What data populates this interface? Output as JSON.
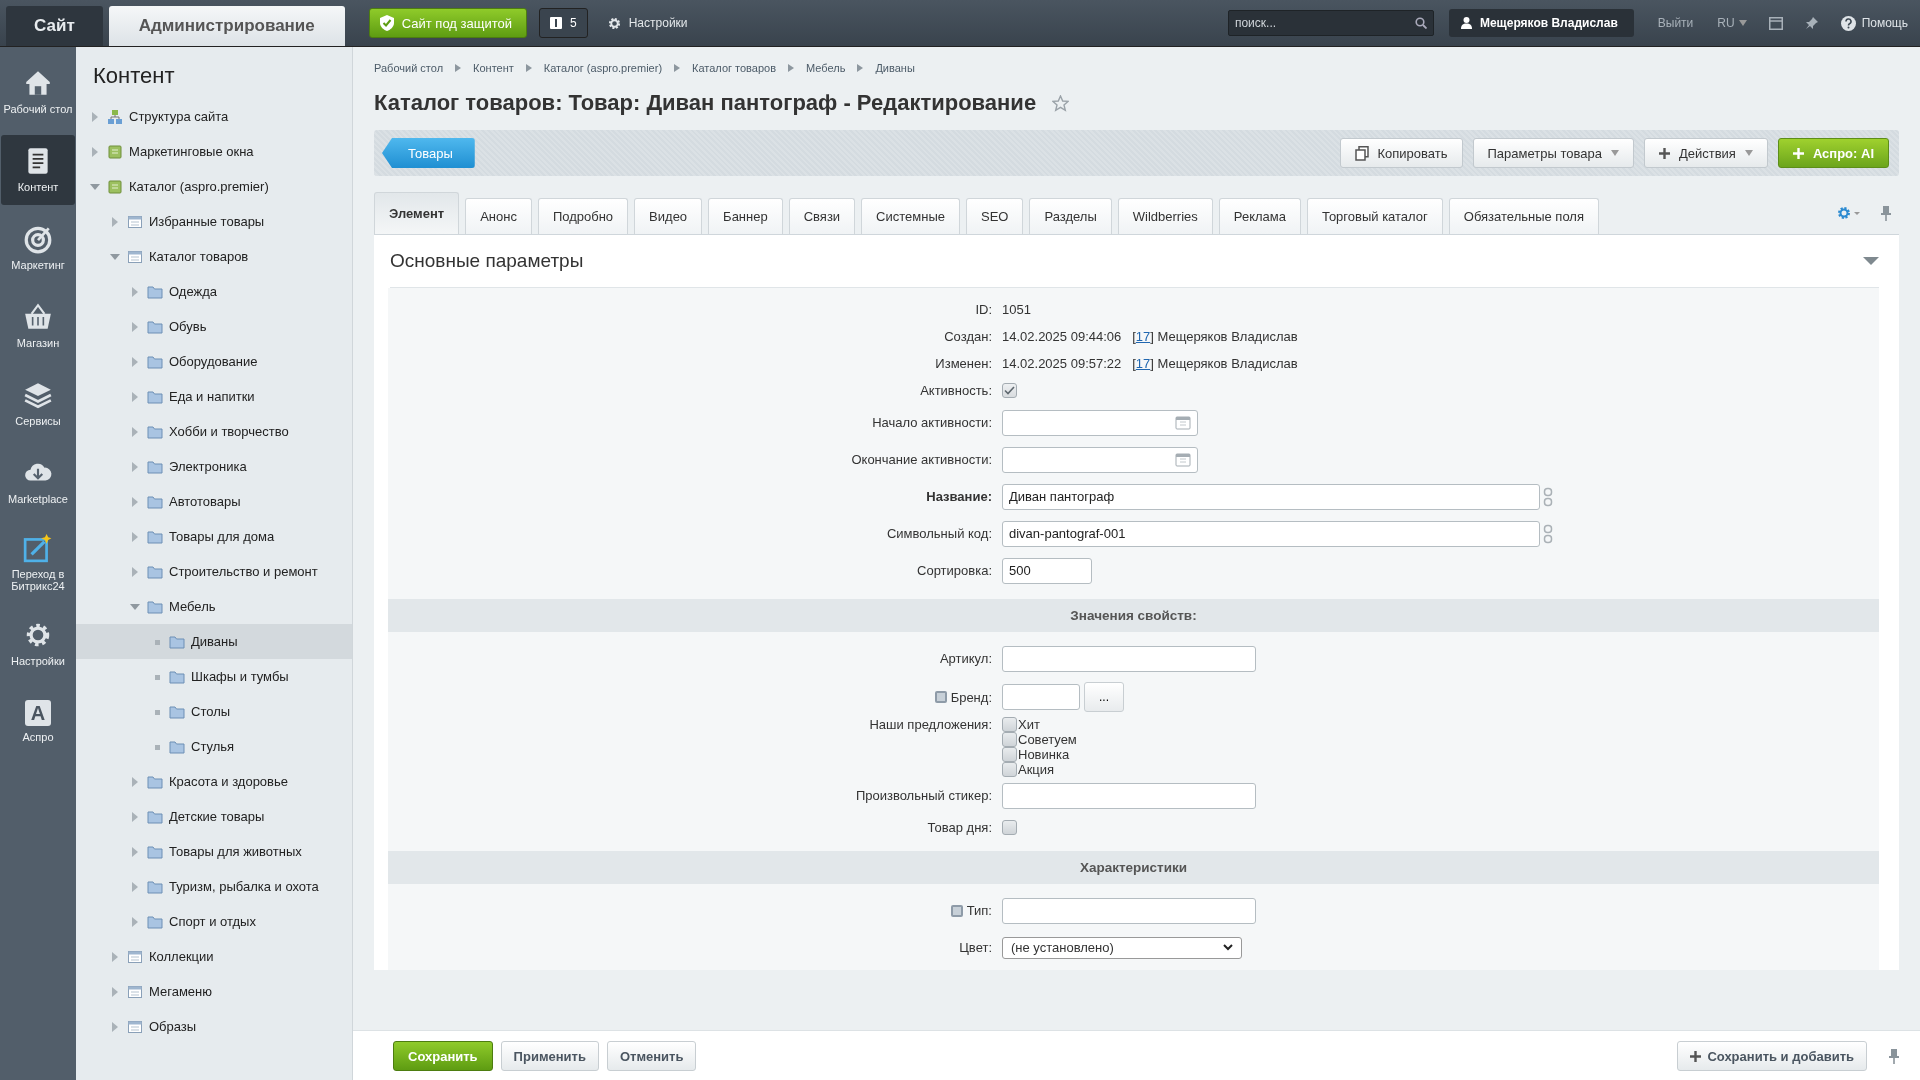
{
  "topbar": {
    "tabs": [
      {
        "label": "Сайт",
        "selected": false
      },
      {
        "label": "Администрирование",
        "selected": true
      }
    ],
    "secure_button": "Сайт под защитой",
    "notifications": "5",
    "settings": "Настройки",
    "search": {
      "placeholder": "поиск..."
    },
    "user": "Мещеряков Владислав",
    "logout": "Выйти",
    "language": "RU",
    "help": "Помощь"
  },
  "nav": [
    {
      "label": "Рабочий стол",
      "selected": false
    },
    {
      "label": "Контент",
      "selected": true
    },
    {
      "label": "Маркетинг",
      "selected": false
    },
    {
      "label": "Магазин",
      "selected": false
    },
    {
      "label": "Сервисы",
      "selected": false
    },
    {
      "label": "Marketplace",
      "selected": false
    },
    {
      "label": "Переход в Битрикс24",
      "selected": false
    },
    {
      "label": "Настройки",
      "selected": false
    },
    {
      "label": "Аспро",
      "glyph": "A",
      "selected": false
    }
  ],
  "tree": {
    "title": "Контент",
    "items": [
      {
        "label": "Структура сайта",
        "expanded": false,
        "selected": false
      },
      {
        "label": "Маркетинговые окна",
        "expanded": false,
        "selected": false
      },
      {
        "label": "Каталог (aspro.premier)",
        "expanded": true,
        "selected": false,
        "children": [
          {
            "label": "Избранные товары",
            "expanded": false,
            "selected": false
          },
          {
            "label": "Каталог товаров",
            "expanded": true,
            "selected": false,
            "children": [
              {
                "label": "Одежда",
                "expanded": false,
                "selected": false
              },
              {
                "label": "Обувь",
                "expanded": false,
                "selected": false
              },
              {
                "label": "Оборудование",
                "expanded": false,
                "selected": false
              },
              {
                "label": "Еда и напитки",
                "expanded": false,
                "selected": false
              },
              {
                "label": "Хобби и творчество",
                "expanded": false,
                "selected": false
              },
              {
                "label": "Электроника",
                "expanded": false,
                "selected": false
              },
              {
                "label": "Автотовары",
                "expanded": false,
                "selected": false
              },
              {
                "label": "Товары для дома",
                "expanded": false,
                "selected": false
              },
              {
                "label": "Строительство и ремонт",
                "expanded": false,
                "selected": false
              },
              {
                "label": "Мебель",
                "expanded": true,
                "selected": false,
                "children": [
                  {
                    "label": "Диваны",
                    "selected": true
                  },
                  {
                    "label": "Шкафы и тумбы",
                    "selected": false
                  },
                  {
                    "label": "Столы",
                    "selected": false
                  },
                  {
                    "label": "Стулья",
                    "selected": false
                  }
                ]
              },
              {
                "label": "Красота и здоровье",
                "expanded": false,
                "selected": false
              },
              {
                "label": "Детские товары",
                "expanded": false,
                "selected": false
              },
              {
                "label": "Товары для животных",
                "expanded": false,
                "selected": false
              },
              {
                "label": "Туризм, рыбалка и охота",
                "expanded": false,
                "selected": false
              },
              {
                "label": "Спорт и отдых",
                "expanded": false,
                "selected": false
              }
            ]
          },
          {
            "label": "Коллекции",
            "expanded": false,
            "selected": false
          },
          {
            "label": "Мегаменю",
            "expanded": false,
            "selected": false
          },
          {
            "label": "Образы",
            "expanded": false,
            "selected": false
          }
        ]
      }
    ]
  },
  "breadcrumbs": [
    "Рабочий стол",
    "Контент",
    "Каталог (aspro.premier)",
    "Каталог товаров",
    "Мебель",
    "Диваны"
  ],
  "page_title": "Каталог товаров: Товар: Диван пантограф - Редактирование",
  "toolbar": {
    "back_button": "Товары",
    "buttons": [
      {
        "label": "Копировать",
        "kind": "copy"
      },
      {
        "label": "Параметры товара",
        "kind": "dropdown"
      },
      {
        "label": "Действия",
        "kind": "plus-dropdown"
      },
      {
        "label": "Аспро: AI",
        "kind": "primary"
      }
    ]
  },
  "tabs": [
    {
      "label": "Элемент",
      "selected": true
    },
    {
      "label": "Анонс",
      "selected": false
    },
    {
      "label": "Подробно",
      "selected": false
    },
    {
      "label": "Видео",
      "selected": false
    },
    {
      "label": "Баннер",
      "selected": false
    },
    {
      "label": "Связи",
      "selected": false
    },
    {
      "label": "Системные",
      "selected": false
    },
    {
      "label": "SEO",
      "selected": false
    },
    {
      "label": "Разделы",
      "selected": false
    },
    {
      "label": "Wildberries",
      "selected": false
    },
    {
      "label": "Реклама",
      "selected": false
    },
    {
      "label": "Торговый каталог",
      "selected": false
    },
    {
      "label": "Обязательные поля",
      "selected": false
    }
  ],
  "section_title": "Основные параметры",
  "fields": [
    {
      "kind": "static",
      "label": "ID:",
      "value": "1051"
    },
    {
      "kind": "author",
      "label": "Создан:",
      "value": "14.02.2025 09:44:06",
      "link_prefix": "[",
      "link": "17",
      "link_suffix": "] Мещеряков Владислав"
    },
    {
      "kind": "author",
      "label": "Изменен:",
      "value": "14.02.2025 09:57:22",
      "link_prefix": "[",
      "link": "17",
      "link_suffix": "] Мещеряков Владислав"
    },
    {
      "kind": "checkbox",
      "label": "Активность:",
      "checked": true
    },
    {
      "kind": "date",
      "label": "Начало активности:"
    },
    {
      "kind": "date",
      "label": "Окончание активности:"
    },
    {
      "kind": "translit",
      "label": "Название:",
      "value": "Диван пантограф",
      "required": true
    },
    {
      "kind": "translit",
      "label": "Символьный код:",
      "value": "divan-pantograf-001",
      "required": false
    },
    {
      "kind": "short",
      "label": "Сортировка:",
      "value": "500"
    },
    {
      "kind": "header",
      "label": "Значения свойств:"
    },
    {
      "kind": "input",
      "label": "Артикул:"
    },
    {
      "kind": "picker",
      "label": "Бренд:",
      "hint": true,
      "button": "..."
    },
    {
      "kind": "checklist",
      "label": "Наши предложения:",
      "options": [
        {
          "label": "Хит",
          "checked": false
        },
        {
          "label": "Советуем",
          "checked": false
        },
        {
          "label": "Новинка",
          "checked": false
        },
        {
          "label": "Акция",
          "checked": false
        }
      ]
    },
    {
      "kind": "input",
      "label": "Произвольный стикер:"
    },
    {
      "kind": "checkbox",
      "label": "Товар дня:",
      "checked": false
    },
    {
      "kind": "header",
      "label": "Характеристики"
    },
    {
      "kind": "input",
      "label": "Тип:",
      "hint": true
    },
    {
      "kind": "select",
      "label": "Цвет:",
      "value": "(не установлено)"
    }
  ],
  "footer": {
    "buttons": [
      {
        "label": "Сохранить",
        "kind": "primary"
      },
      {
        "label": "Применить",
        "kind": "plain"
      },
      {
        "label": "Отменить",
        "kind": "plain"
      }
    ],
    "add_button": "Сохранить и добавить"
  }
}
